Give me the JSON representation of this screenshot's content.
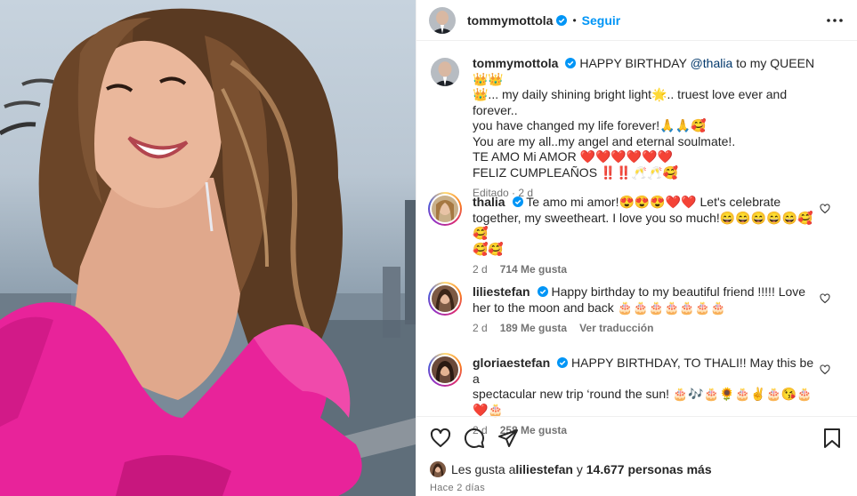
{
  "post": {
    "author": "tommymottola",
    "follow_label": "Seguir",
    "caption": {
      "line1_a": "HAPPY BIRTHDAY ",
      "mention": "@thalia",
      "line1_b": " to my QUEEN 👑👑",
      "line2": "👑... my daily shining bright light🌟.. truest love ever and forever..",
      "line3": "you have changed my life forever!🙏🙏🥰",
      "line4": "You are my all..my angel and eternal soulmate!.",
      "line5": "TE AMO Mi AMOR ❤️❤️❤️❤️❤️❤️",
      "line6": "FELIZ CUMPLEAÑOS ‼️‼️🥂🥂🥰"
    },
    "edited_label": "Editado",
    "edited_time": "2 d"
  },
  "comments": [
    {
      "user": "thalia",
      "text_l1": "Te amo mi amor!😍😍😍❤️❤️ Let's celebrate",
      "text_l2": "together, my sweetheart. I love you so much!😄😄😄😄😄🥰🥰",
      "text_l3": "🥰🥰",
      "time": "2 d",
      "likes": "714 Me gusta"
    },
    {
      "user": "liliestefan",
      "text_l1": "Happy birthday to my beautiful friend !!!!! Love",
      "text_l2": "her to the moon and back 🎂🎂🎂🎂🎂🎂🎂",
      "time": "2 d",
      "likes": "189 Me gusta",
      "translate": "Ver traducción"
    },
    {
      "user": "gloriaestefan",
      "text_l1": "HAPPY BIRTHDAY, TO THALI!! May this be a",
      "text_l2": "spectacular new trip ‘round the sun! 🎂🎶🎂🌻🎂✌️🎂😘🎂❤️🎂",
      "time": "2 d",
      "likes": "258 Me gusta"
    }
  ],
  "likes_summary": {
    "prefix": "Les gusta a ",
    "user": "liliestefan",
    "middle": " y ",
    "count": "14.677 personas más"
  },
  "posted_ago": "Hace 2 días",
  "colors": {
    "accent": "#0095f6",
    "verified": "#0095f6",
    "dress": "#e8239a",
    "heart": "#ed4956"
  },
  "icons": [
    "more-icon",
    "heart-icon",
    "comment-icon",
    "share-icon",
    "bookmark-icon",
    "verified-icon"
  ]
}
